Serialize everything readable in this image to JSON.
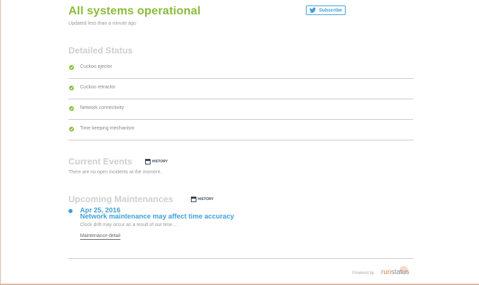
{
  "header": {
    "title": "All systems operational",
    "updated": "Updated less than a minute ago",
    "subscribe_label": "Subscribe"
  },
  "detailed_status": {
    "title": "Detailed Status",
    "items": [
      {
        "label": "Cuckoo ejector",
        "status": "operational"
      },
      {
        "label": "Cuckoo retractor",
        "status": "operational"
      },
      {
        "label": "Network connectivity",
        "status": "operational"
      },
      {
        "label": "Time keeping mechanism",
        "status": "operational"
      }
    ]
  },
  "current_events": {
    "title": "Current Events",
    "history_label": "HISTORY",
    "empty_text": "There are no open incidents at the moment."
  },
  "upcoming": {
    "title": "Upcoming Maintenances",
    "history_label": "HISTORY",
    "item": {
      "date": "Apr 25, 2016",
      "name": "Network maintenance may affect time accuracy",
      "description": "Clock drift may occur as a result of our time ...",
      "link_label": "Maintenance detail"
    }
  },
  "footer": {
    "powered_by": "Powered by",
    "brand_run": "run",
    "brand_status": "status"
  },
  "colors": {
    "operational_green": "#8cbc3a",
    "accent_blue": "#3fa0d9",
    "section_gray": "#cfcfcf",
    "brand_orange": "#e07a3c"
  },
  "icons": {
    "subscribe": "twitter-bird-icon",
    "status": "check-circle-icon",
    "history": "calendar-icon",
    "maintenance": "bullet-dot-icon"
  }
}
